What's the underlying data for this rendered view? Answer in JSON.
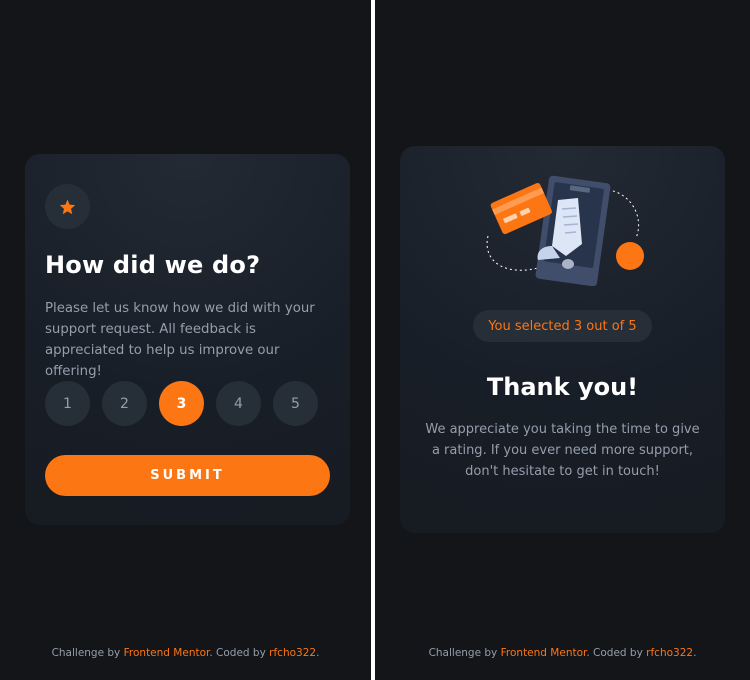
{
  "colors": {
    "background": "#141519",
    "card": "#181e27",
    "accent": "#fc7614",
    "muted": "#959eac",
    "chip": "#262e38",
    "white": "#ffffff"
  },
  "rating_card": {
    "icon": "star-icon",
    "title": "How did we do?",
    "description": "Please let us know how we did with your support request. All feedback is appreciated to help us improve our offering!",
    "options": [
      "1",
      "2",
      "3",
      "4",
      "5"
    ],
    "selected": "3",
    "submit_label": "SUBMIT"
  },
  "thanks_card": {
    "illustration": "phone-receipt-card-illustration",
    "selected_text": "You selected 3 out of 5",
    "title": "Thank you!",
    "description": "We appreciate you taking the time to give a rating. If you ever need more support, don't hesitate to get in touch!"
  },
  "attribution": {
    "prefix": "Challenge by",
    "frontend_mentor": "Frontend Mentor",
    "middle": ". Coded by",
    "author": "rfcho322",
    "suffix": "."
  }
}
